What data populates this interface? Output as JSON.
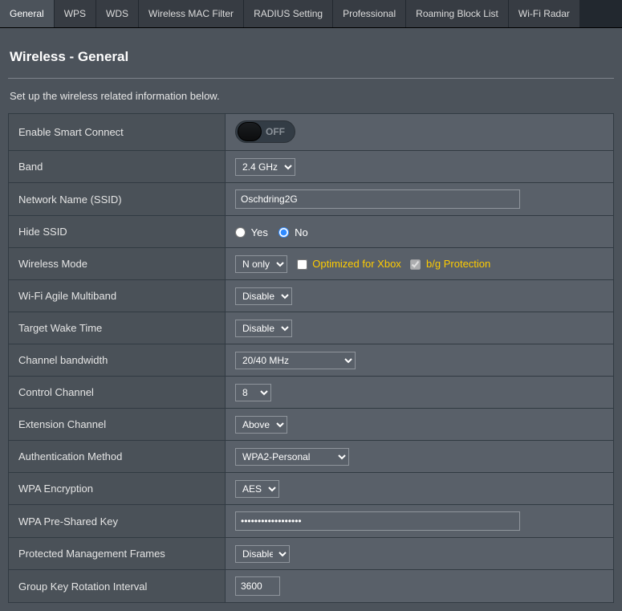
{
  "tabs": [
    {
      "label": "General",
      "active": true
    },
    {
      "label": "WPS"
    },
    {
      "label": "WDS"
    },
    {
      "label": "Wireless MAC Filter"
    },
    {
      "label": "RADIUS Setting"
    },
    {
      "label": "Professional"
    },
    {
      "label": "Roaming Block List"
    },
    {
      "label": "Wi-Fi Radar"
    }
  ],
  "page": {
    "title": "Wireless - General",
    "subtitle": "Set up the wireless related information below."
  },
  "form": {
    "smartConnect": {
      "label": "Enable Smart Connect",
      "state": "OFF"
    },
    "band": {
      "label": "Band",
      "value": "2.4 GHz"
    },
    "ssid": {
      "label": "Network Name (SSID)",
      "value": "Oschdring2G"
    },
    "hideSsid": {
      "label": "Hide SSID",
      "yes": "Yes",
      "no": "No",
      "selected": "no"
    },
    "wirelessMode": {
      "label": "Wireless Mode",
      "value": "N only",
      "xbox": "Optimized for Xbox",
      "bg": "b/g Protection"
    },
    "agile": {
      "label": "Wi-Fi Agile Multiband",
      "value": "Disable"
    },
    "twt": {
      "label": "Target Wake Time",
      "value": "Disable"
    },
    "bandwidth": {
      "label": "Channel bandwidth",
      "value": "20/40 MHz"
    },
    "controlCh": {
      "label": "Control Channel",
      "value": "8"
    },
    "extCh": {
      "label": "Extension Channel",
      "value": "Above"
    },
    "auth": {
      "label": "Authentication Method",
      "value": "WPA2-Personal"
    },
    "wpaEnc": {
      "label": "WPA Encryption",
      "value": "AES"
    },
    "psk": {
      "label": "WPA Pre-Shared Key",
      "value": "••••••••••••••••••"
    },
    "pmf": {
      "label": "Protected Management Frames",
      "value": "Disable"
    },
    "groupKey": {
      "label": "Group Key Rotation Interval",
      "value": "3600"
    }
  }
}
